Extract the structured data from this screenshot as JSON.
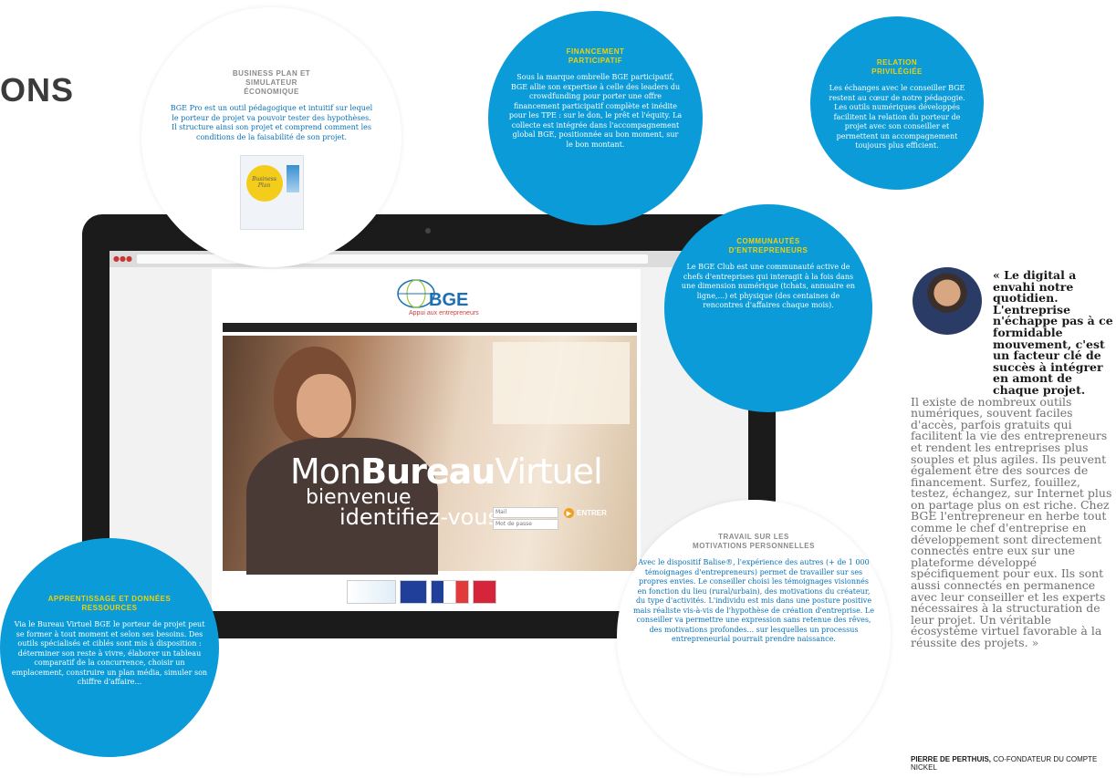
{
  "section_title": "ONS",
  "bubbles": {
    "business_plan": {
      "title": "BUSINESS PLAN ET SIMULATEUR ÉCONOMIQUE",
      "text": "BGE Pro est un outil pédagogique et intuitif sur lequel le porteur de projet va pouvoir tester des hypothèses. Il structure ainsi son projet et comprend comment les conditions de la faisabilité de son projet.",
      "booklet_label": "Business Plan"
    },
    "financement": {
      "title": "FINANCEMENT PARTICIPATIF",
      "text": "Sous la marque ombrelle BGE participatif, BGE allie son expertise à celle des leaders du crowdfunding pour porter une offre financement participatif complète et inédite pour les TPE : sur le don, le prêt et l'équity. La collecte est intégrée dans l'accompagnement global BGE, positionnée au bon moment, sur le bon montant."
    },
    "relation": {
      "title": "RELATION PRIVILÉGIÉE",
      "text": "Les échanges avec le conseiller BGE restent au cœur de notre pédagogie. Les outils numériques développés facilitent la relation du porteur de projet avec son conseiller et permettent un accompagnement toujours plus efficient."
    },
    "communautes": {
      "title": "COMMUNAUTÉS D'ENTREPRENEURS",
      "text": "Le BGE Club est une communauté active de chefs d'entreprises qui interagit à la fois dans une dimension numérique (tchats, annuaire en ligne,...) et physique (des centaines de rencontres d'affaires chaque mois)."
    },
    "apprentissage": {
      "title": "APPRENTISSAGE ET DONNÉES RESSOURCES",
      "text": "Via le Bureau Virtuel BGE le porteur de projet peut se former à tout moment et selon ses besoins. Des outils spécialisés et ciblés sont mis à disposition : déterminer son reste à vivre, élaborer un tableau comparatif de la concurrence, choisir un emplacement, construire un plan média, simuler son chiffre d'affaire..."
    },
    "travail": {
      "title": "TRAVAIL SUR LES MOTIVATIONS PERSONNELLES",
      "text": "Avec le dispositif Balise®, l'expérience des autres (+ de 1 000 témoignages d'entrepreneurs) permet de travailler sur ses propres envies. Le conseiller choisi les témoignages visionnés en fonction du lieu (rural/urbain), des motivations du créateur, du type d'activités. L'individu est mis dans une posture positive mais réaliste vis-à-vis de l'hypothèse de création d'entreprise. Le conseiller va permettre une expression sans retenue des rêves, des motivations profondes... sur lesquelles un processus entrepreneurial pourrait prendre naissance."
    }
  },
  "screen": {
    "logo": "BGE",
    "logo_tagline": "Appui aux entrepreneurs",
    "headline_prefix": "Mon",
    "headline_bold": "Bureau",
    "headline_suffix": "Virtuel",
    "welcome": "bienvenue",
    "identify": "identifiez-vous",
    "login_placeholder": "Mail",
    "password_placeholder": "Mot de passe",
    "enter_label": "ENTRER"
  },
  "quote": {
    "bold_lead": "« Le digital a envahi notre quotidien. L'entreprise n'échappe pas à ce formidable mouvement, c'est un facteur clé de succès à intégrer en amont de chaque projet.",
    "body": "Il existe de nombreux outils numériques, souvent faciles d'accès, parfois gratuits qui facilitent la vie des entrepreneurs et rendent les entreprises plus souples et plus agiles. Ils peuvent également être des sources de financement. Surfez, fouillez, testez, échangez, sur Internet plus on partage plus on est riche. Chez BGE l'entrepreneur en herbe tout comme le chef d'entreprise en développement sont directement connectés entre eux sur une plateforme développé spécifiquement pour eux. Ils sont aussi connectés en permanence avec leur conseiller et les experts nécessaires à la structuration de leur projet. Un véritable écosystème virtuel favorable à la réussite des projets. »",
    "author_name": "PIERRE DE PERTHUIS,",
    "author_role": "CO-FONDATEUR DU COMPTE NICKEL"
  },
  "colors": {
    "bubble_blue": "#0a9bd8",
    "bubble_title_yellow": "#f5d000",
    "text_blue": "#0a72b8"
  }
}
